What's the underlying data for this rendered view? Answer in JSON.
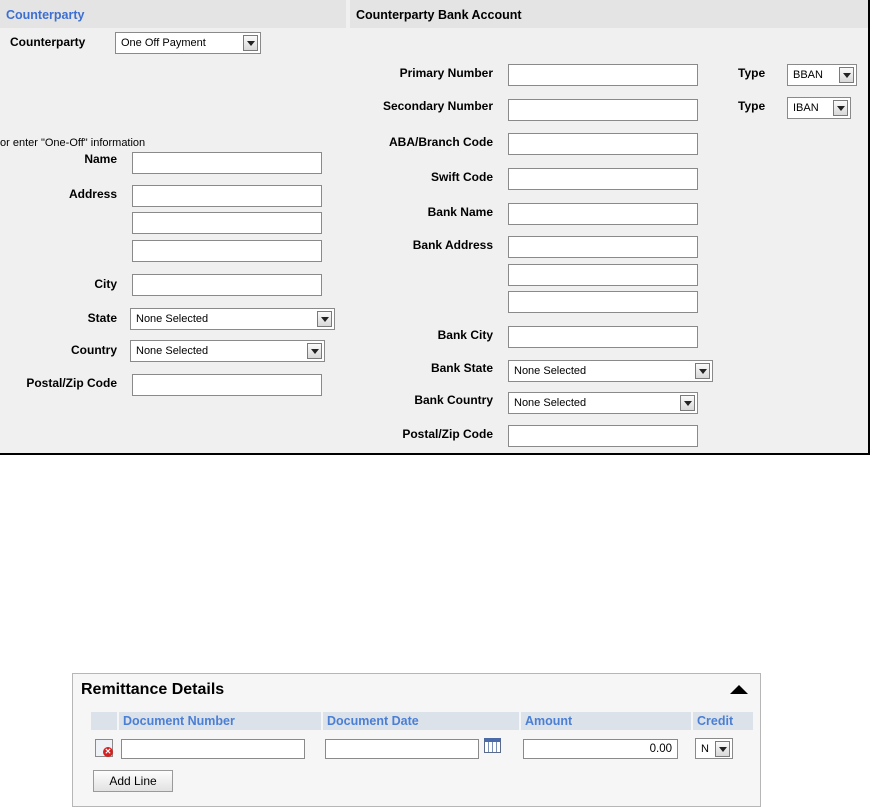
{
  "counterparty": {
    "header": "Counterparty",
    "counterparty_label": "Counterparty",
    "counterparty_value": "One Off Payment",
    "oneoff_note": "or enter \"One-Off\" information",
    "name_label": "Name",
    "address_label": "Address",
    "city_label": "City",
    "state_label": "State",
    "state_value": "None Selected",
    "country_label": "Country",
    "country_value": "None Selected",
    "postal_label": "Postal/Zip Code"
  },
  "bank": {
    "header": "Counterparty Bank Account",
    "primary_label": "Primary Number",
    "secondary_label": "Secondary Number",
    "type_label": "Type",
    "primary_type": "BBAN",
    "secondary_type": "IBAN",
    "aba_label": "ABA/Branch Code",
    "swift_label": "Swift Code",
    "name_label": "Bank Name",
    "address_label": "Bank Address",
    "city_label": "Bank City",
    "state_label": "Bank State",
    "state_value": "None Selected",
    "country_label": "Bank Country",
    "country_value": "None Selected",
    "postal_label": "Postal/Zip Code"
  },
  "remittance": {
    "title": "Remittance Details",
    "columns": [
      "Document Number",
      "Document Date",
      "Amount",
      "Credit"
    ],
    "row": {
      "amount": "0.00",
      "credit": "N"
    },
    "add_line": "Add Line"
  },
  "colors": {
    "link_blue": "#3d6fd0",
    "panel_bg": "#f0f0f0",
    "header_bg": "#e4e4e4"
  },
  "icons": [
    "dropdown-arrow-icon",
    "calendar-icon",
    "delete-row-icon",
    "collapse-arrow-icon"
  ]
}
